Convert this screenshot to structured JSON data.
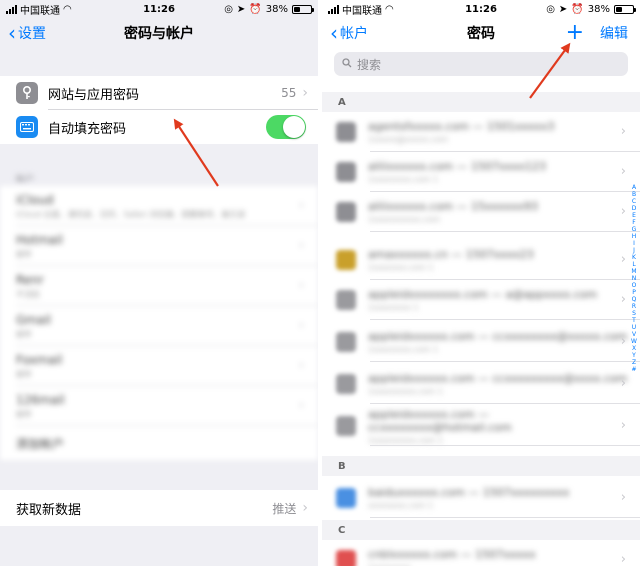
{
  "left_screen": {
    "status": {
      "carrier": "中国联通",
      "time": "11:26",
      "battery": "38%",
      "battery_level": 0.38
    },
    "nav": {
      "back_label": "设置",
      "title": "密码与帐户"
    },
    "group1": {
      "passwords_label": "网站与应用密码",
      "passwords_count": "55",
      "autofill_label": "自动填充密码",
      "autofill_on": true
    },
    "accounts": {
      "header": "帐户",
      "items": [
        {
          "name": "iCloud",
          "detail": "iCloud 云盘、通讯录、日历、Safari 浏览器、提醒事项、备忘录"
        },
        {
          "name": "Hotmail",
          "detail": "邮件"
        },
        {
          "name": "Renr",
          "detail": "不活跃"
        },
        {
          "name": "Gmail",
          "detail": "邮件"
        },
        {
          "name": "Foxmail",
          "detail": "邮件"
        },
        {
          "name": "126mail",
          "detail": "邮件"
        }
      ],
      "add_label": "添加帐户"
    },
    "fetch": {
      "label": "获取新数据",
      "value": "推送"
    }
  },
  "right_screen": {
    "status": {
      "carrier": "中国联通",
      "time": "11:26",
      "battery": "38%",
      "battery_level": 0.38
    },
    "nav": {
      "back_label": "帐户",
      "title": "密码",
      "plus": "+",
      "edit_label": "编辑"
    },
    "search_placeholder": "搜索",
    "sections": [
      {
        "letter": "A"
      },
      {
        "letter": "B"
      },
      {
        "letter": "C"
      }
    ],
    "entries": [
      {
        "t1": "agentsfxxxxx.com — 1501xxxxx3",
        "t2": "1xxxxx@xxxxx.com",
        "color": "#8e8e93"
      },
      {
        "t1": "aliiixxxxxx.com — 1507xxxx123",
        "t2": "1xxxxxxxx.com 1",
        "color": "#8e8e93"
      },
      {
        "t1": "aliiixxxxxx.com — 15xxxxxx93",
        "t2": "1xxxxxxxxxx.com",
        "color": "#8e8e93"
      },
      {
        "t1": "amaxxxxxx.cn — 1507xxxx23",
        "t2": "1xxxxxxx.com 1",
        "color": "#c9a02b"
      },
      {
        "t1": "appleidxxxxxxxx.com — a@appxxxx.com",
        "t2": "1xxxxxxxx 1",
        "color": "#9a9a9e"
      },
      {
        "t1": "appleidxxxxxx.com — ccxxxxxxxx@xxxxx.com",
        "t2": "1xxxxxxxx.com 1",
        "color": "#9a9a9e"
      },
      {
        "t1": "appleidxxxxxx.com — ccxxxxxxxxx@xxxx.com",
        "t2": "1xxxxxxxxx.com 1",
        "color": "#9a9a9e"
      },
      {
        "t1": "appleidxxxxxx.com — ccxxxxxxxx@hotmail.com",
        "t2": "1xxxxxxxxx.com 1",
        "color": "#9a9a9e"
      },
      {
        "t1": "baiduxxxxxx.com — 1507xxxxxxxxx",
        "t2": "xxxxxxxx.com 1",
        "color": "#4a90e2"
      },
      {
        "t1": "cnblxxxxxx.com — 1507xxxxx",
        "t2": "1xxxxxxxx",
        "color": "#e05050"
      }
    ],
    "alpha_index": [
      "A",
      "B",
      "C",
      "D",
      "E",
      "F",
      "G",
      "H",
      "I",
      "J",
      "K",
      "L",
      "M",
      "N",
      "O",
      "P",
      "Q",
      "R",
      "S",
      "T",
      "U",
      "V",
      "W",
      "X",
      "Y",
      "Z",
      "#"
    ]
  },
  "annotations": {
    "arrow_color": "#e03a1e"
  }
}
